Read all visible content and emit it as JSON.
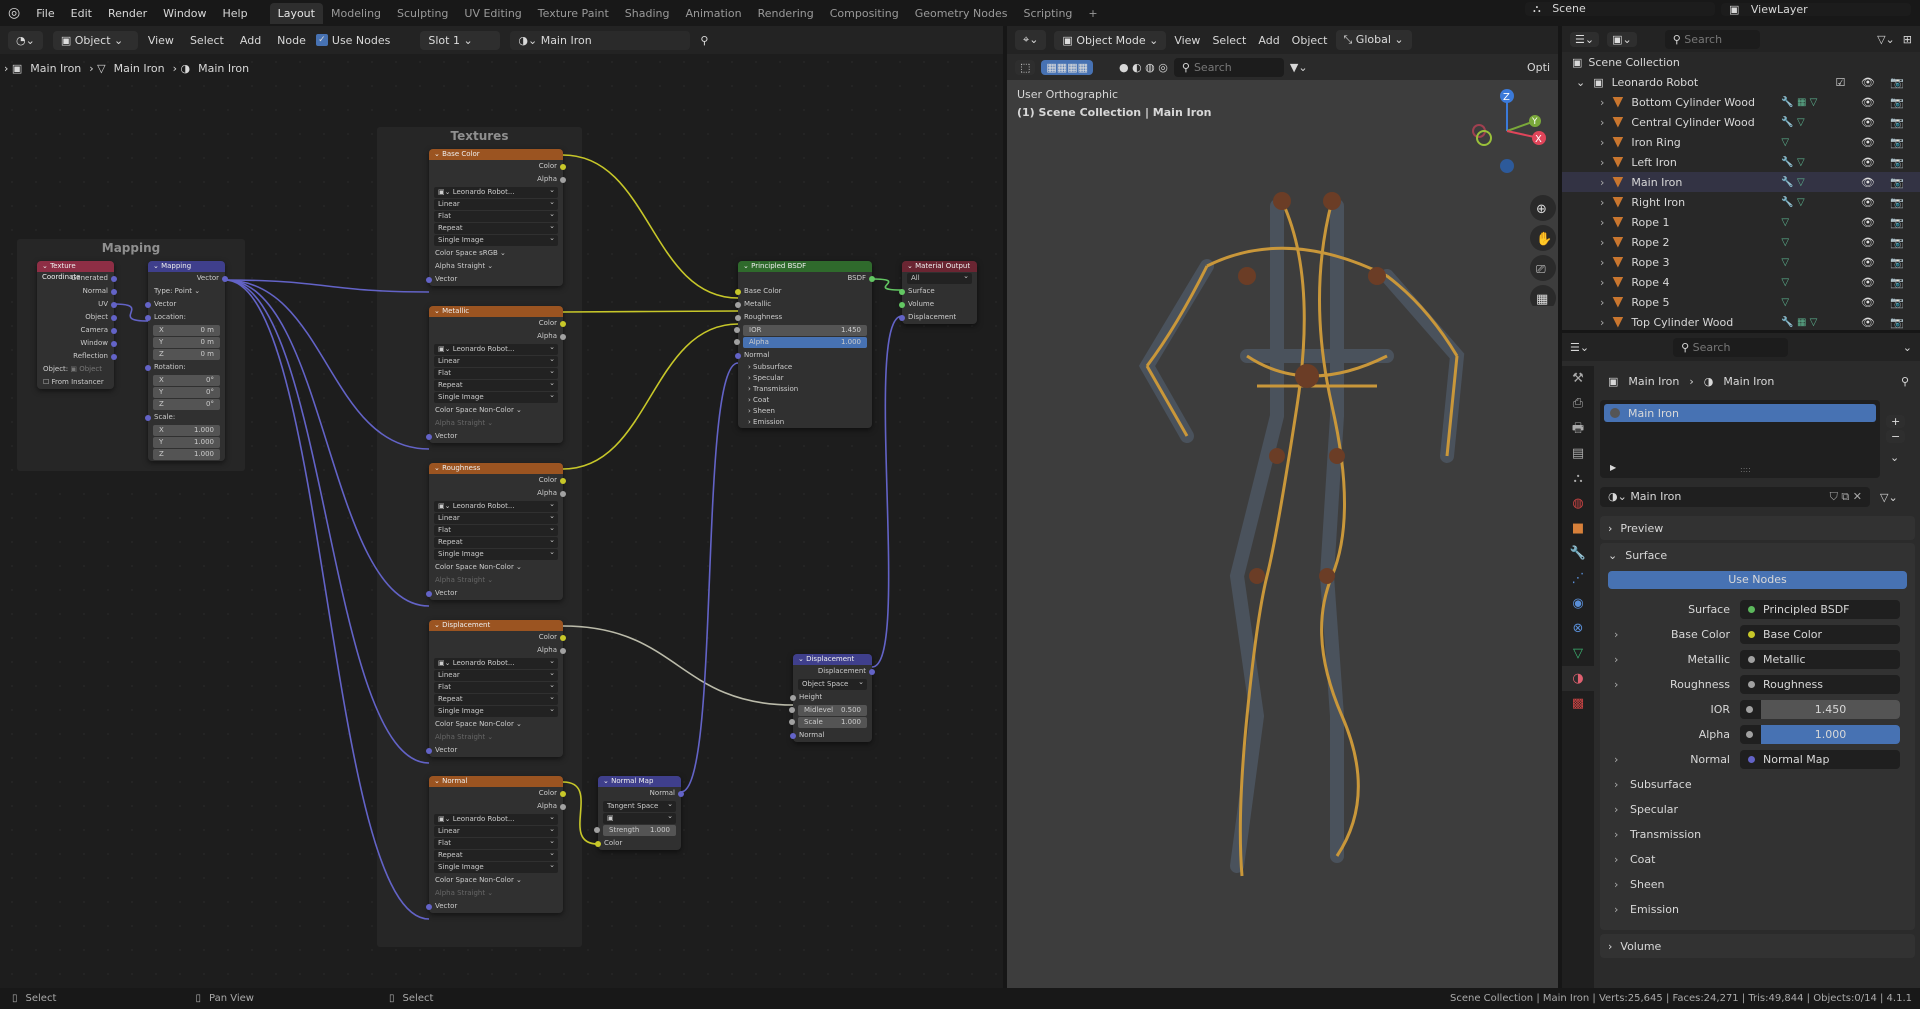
{
  "topbar": {
    "menus": [
      "File",
      "Edit",
      "Render",
      "Window",
      "Help"
    ],
    "workspaces": [
      "Layout",
      "Modeling",
      "Sculpting",
      "UV Editing",
      "Texture Paint",
      "Shading",
      "Animation",
      "Rendering",
      "Compositing",
      "Geometry Nodes",
      "Scripting"
    ],
    "active_workspace": "Layout",
    "scene": "Scene",
    "view_layer": "ViewLayer"
  },
  "node_header": {
    "mode": "Object",
    "menus": [
      "View",
      "Select",
      "Add",
      "Node"
    ],
    "use_nodes_label": "Use Nodes",
    "use_nodes": true,
    "slot": "Slot 1",
    "material": "Main Iron"
  },
  "breadcrumb": [
    "Main Iron",
    "Main Iron",
    "Main Iron"
  ],
  "frames": {
    "mapping": "Mapping",
    "textures": "Textures"
  },
  "tex_coord": {
    "title": "Texture Coordinate",
    "outputs": [
      "Generated",
      "Normal",
      "UV",
      "Object",
      "Camera",
      "Window",
      "Reflection"
    ],
    "object_label": "Object:",
    "object_placeholder": "Object",
    "from_instancer": "From Instancer"
  },
  "mapping": {
    "title": "Mapping",
    "output": "Vector",
    "type_label": "Type:",
    "type": "Point",
    "vector": "Vector",
    "location": "Location:",
    "loc": [
      [
        "X",
        "0 m"
      ],
      [
        "Y",
        "0 m"
      ],
      [
        "Z",
        "0 m"
      ]
    ],
    "rotation": "Rotation:",
    "rot": [
      [
        "X",
        "0°"
      ],
      [
        "Y",
        "0°"
      ],
      [
        "Z",
        "0°"
      ]
    ],
    "scale": "Scale:",
    "scl": [
      [
        "X",
        "1.000"
      ],
      [
        "Y",
        "1.000"
      ],
      [
        "Z",
        "1.000"
      ]
    ]
  },
  "textures": [
    {
      "title": "Base Color",
      "image": "Leonardo Robot...",
      "interp": "Linear",
      "proj": "Flat",
      "ext": "Repeat",
      "src": "Single Image",
      "color_space": "sRGB",
      "alpha": "Straight"
    },
    {
      "title": "Metallic",
      "image": "Leonardo Robot...",
      "interp": "Linear",
      "proj": "Flat",
      "ext": "Repeat",
      "src": "Single Image",
      "color_space": "Non-Color",
      "alpha": "Straight"
    },
    {
      "title": "Roughness",
      "image": "Leonardo Robot...",
      "interp": "Linear",
      "proj": "Flat",
      "ext": "Repeat",
      "src": "Single Image",
      "color_space": "Non-Color",
      "alpha": "Straight"
    },
    {
      "title": "Displacement",
      "image": "Leonardo Robot...",
      "interp": "Linear",
      "proj": "Flat",
      "ext": "Repeat",
      "src": "Single Image",
      "color_space": "Non-Color",
      "alpha": "Straight"
    },
    {
      "title": "Normal",
      "image": "Leonardo Robot...",
      "interp": "Linear",
      "proj": "Flat",
      "ext": "Repeat",
      "src": "Single Image",
      "color_space": "Non-Color",
      "alpha": "Straight"
    }
  ],
  "tex_labels": {
    "color": "Color",
    "alpha": "Alpha",
    "color_space": "Color Space",
    "alpha_mode": "Alpha",
    "vector": "Vector"
  },
  "bsdf": {
    "title": "Principled BSDF",
    "output": "BSDF",
    "inputs": [
      "Base Color",
      "Metallic",
      "Roughness"
    ],
    "ior_label": "IOR",
    "ior": "1.450",
    "alpha_label": "Alpha",
    "alpha": "1.000",
    "normal": "Normal",
    "panels": [
      "Subsurface",
      "Specular",
      "Transmission",
      "Coat",
      "Sheen",
      "Emission"
    ]
  },
  "mat_output": {
    "title": "Material Output",
    "target": "All",
    "inputs": [
      "Surface",
      "Volume",
      "Displacement"
    ]
  },
  "displacement": {
    "title": "Displacement",
    "output": "Displacement",
    "space": "Object Space",
    "height": "Height",
    "midlevel_label": "Midlevel",
    "midlevel": "0.500",
    "scale_label": "Scale",
    "scale": "1.000",
    "normal": "Normal"
  },
  "normal_map": {
    "title": "Normal Map",
    "output": "Normal",
    "space": "Tangent Space",
    "strength_label": "Strength",
    "strength": "1.000",
    "color": "Color"
  },
  "viewport": {
    "mode": "Object Mode",
    "menus": [
      "View",
      "Select",
      "Add",
      "Object"
    ],
    "orientation": "Global",
    "search_placeholder": "Search",
    "options": "Opti",
    "view_name": "User Orthographic",
    "context": "(1) Scene Collection | Main Iron",
    "gizmo": {
      "z": "Z",
      "y": "Y",
      "x": "X"
    }
  },
  "outliner": {
    "search_placeholder": "Search",
    "root": "Scene Collection",
    "collection": "Leonardo Robot",
    "objects": [
      {
        "name": "Bottom Cylinder Wood",
        "mods": "🔧 ▦ ▽"
      },
      {
        "name": "Central Cylinder Wood",
        "mods": "🔧 ▽"
      },
      {
        "name": "Iron Ring",
        "mods": "▽"
      },
      {
        "name": "Left Iron",
        "mods": "🔧 ▽"
      },
      {
        "name": "Main Iron",
        "mods": "🔧 ▽",
        "active": true
      },
      {
        "name": "Right Iron",
        "mods": "🔧 ▽"
      },
      {
        "name": "Rope 1",
        "mods": "▽"
      },
      {
        "name": "Rope 2",
        "mods": "▽"
      },
      {
        "name": "Rope 3",
        "mods": "▽"
      },
      {
        "name": "Rope 4",
        "mods": "▽"
      },
      {
        "name": "Rope 5",
        "mods": "▽"
      },
      {
        "name": "Top Cylinder Wood",
        "mods": "🔧 ▦ ▽"
      }
    ]
  },
  "properties": {
    "search_placeholder": "Search",
    "breadcrumb": [
      "Main Iron",
      "Main Iron"
    ],
    "slot": "Main Iron",
    "material": "Main Iron",
    "preview": "Preview",
    "surface_panel": "Surface",
    "use_nodes": "Use Nodes",
    "rows": [
      {
        "label": "Surface",
        "value": "Principled BSDF",
        "dot": "#5cb85c"
      },
      {
        "label": "Base Color",
        "value": "Base Color",
        "dot": "#c7c729",
        "chev": true
      },
      {
        "label": "Metallic",
        "value": "Metallic",
        "dot": "#a1a1a1",
        "chev": true
      },
      {
        "label": "Roughness",
        "value": "Roughness",
        "dot": "#a1a1a1",
        "chev": true
      }
    ],
    "ior_label": "IOR",
    "ior": "1.450",
    "alpha_label": "Alpha",
    "alpha": "1.000",
    "normal_label": "Normal",
    "normal": "Normal Map",
    "subpanels": [
      "Subsurface",
      "Specular",
      "Transmission",
      "Coat",
      "Sheen",
      "Emission"
    ],
    "volume": "Volume"
  },
  "status": {
    "left": [
      [
        "Select"
      ],
      [
        "Pan View"
      ],
      [
        "Select"
      ]
    ],
    "right": "Scene Collection | Main Iron | Verts:25,645 | Faces:24,271 | Tris:49,844 | Objects:0/14 | 4.1.1"
  },
  "colors": {
    "accent": "#4772b3",
    "texture_header": "#9b5421",
    "bsdf_header": "#2f6a2c",
    "output_header": "#6a2532",
    "vector_header": "#3f3f8c",
    "input_header": "#8e2e45",
    "color_socket": "#c7c729",
    "float_socket": "#a1a1a1",
    "vector_socket": "#6363c7",
    "shader_socket": "#63c763"
  }
}
